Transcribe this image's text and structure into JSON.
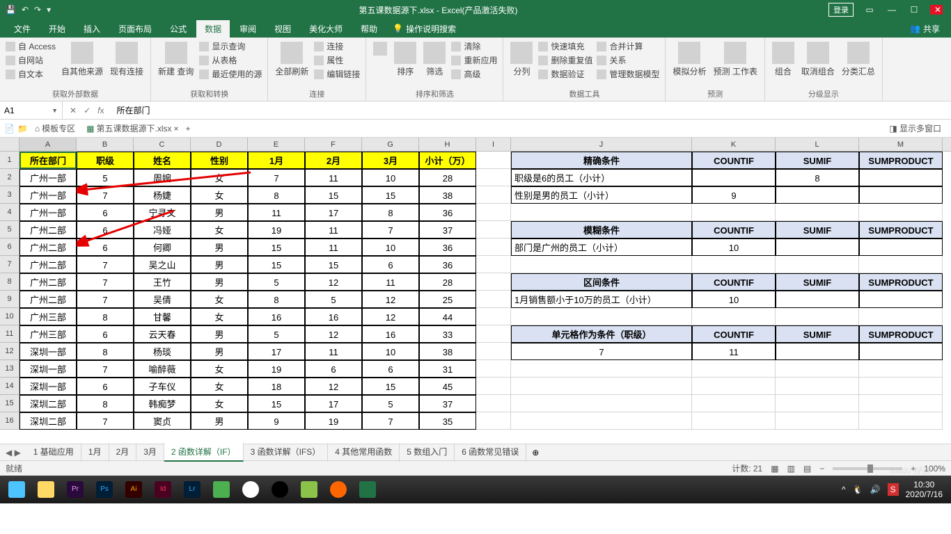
{
  "titlebar": {
    "title": "第五课数据源下.xlsx - Excel(产品激活失败)",
    "login": "登录"
  },
  "tabs": {
    "file": "文件",
    "home": "开始",
    "insert": "插入",
    "layout": "页面布局",
    "formula": "公式",
    "data": "数据",
    "review": "审阅",
    "view": "视图",
    "beautify": "美化大师",
    "help": "帮助",
    "tell": "操作说明搜索",
    "share": "共享"
  },
  "ribbon": {
    "g1": {
      "items": [
        "自 Access",
        "自网站",
        "自文本"
      ],
      "big1": "自其他来源",
      "big2": "现有连接",
      "label": "获取外部数据"
    },
    "g2": {
      "big": "新建\n查询",
      "items": [
        "显示查询",
        "从表格",
        "最近使用的源"
      ],
      "label": "获取和转换"
    },
    "g3": {
      "big": "全部刷新",
      "items": [
        "连接",
        "属性",
        "编辑链接"
      ],
      "label": "连接"
    },
    "g4": {
      "sort": "排序",
      "filter": "筛选",
      "items": [
        "清除",
        "重新应用",
        "高级"
      ],
      "label": "排序和筛选"
    },
    "g5": {
      "big": "分列",
      "items": [
        "快速填充",
        "删除重复值",
        "数据验证"
      ],
      "items2": [
        "合并计算",
        "关系",
        "管理数据模型"
      ],
      "label": "数据工具"
    },
    "g6": {
      "b1": "模拟分析",
      "b2": "预测\n工作表",
      "label": "预测"
    },
    "g7": {
      "b1": "组合",
      "b2": "取消组合",
      "b3": "分类汇总",
      "label": "分级显示"
    }
  },
  "namebox": "A1",
  "fx": "所在部门",
  "filetabs": {
    "tpl": "模板专区",
    "file": "第五课数据源下.xlsx",
    "multi": "显示多窗口"
  },
  "cols": [
    "A",
    "B",
    "C",
    "D",
    "E",
    "F",
    "G",
    "H",
    "I",
    "J",
    "K",
    "L",
    "M"
  ],
  "headers": {
    "A": "所在部门",
    "B": "职级",
    "C": "姓名",
    "D": "性别",
    "E": "1月",
    "F": "2月",
    "G": "3月",
    "H": "小计（万）"
  },
  "data": [
    [
      "广州一部",
      "5",
      "周婉",
      "女",
      "7",
      "11",
      "10",
      "28"
    ],
    [
      "广州一部",
      "7",
      "杨婕",
      "女",
      "8",
      "15",
      "15",
      "38"
    ],
    [
      "广州一部",
      "6",
      "宁寻文",
      "男",
      "11",
      "17",
      "8",
      "36"
    ],
    [
      "广州二部",
      "6",
      "冯娅",
      "女",
      "19",
      "11",
      "7",
      "37"
    ],
    [
      "广州二部",
      "6",
      "何卿",
      "男",
      "15",
      "11",
      "10",
      "36"
    ],
    [
      "广州二部",
      "7",
      "吴之山",
      "男",
      "15",
      "15",
      "6",
      "36"
    ],
    [
      "广州二部",
      "7",
      "王竹",
      "男",
      "5",
      "12",
      "11",
      "28"
    ],
    [
      "广州二部",
      "7",
      "吴倩",
      "女",
      "8",
      "5",
      "12",
      "25"
    ],
    [
      "广州三部",
      "8",
      "甘馨",
      "女",
      "16",
      "16",
      "12",
      "44"
    ],
    [
      "广州三部",
      "6",
      "云天春",
      "男",
      "5",
      "12",
      "16",
      "33"
    ],
    [
      "深圳一部",
      "8",
      "杨琰",
      "男",
      "17",
      "11",
      "10",
      "38"
    ],
    [
      "深圳一部",
      "7",
      "喻醉薇",
      "女",
      "19",
      "6",
      "6",
      "31"
    ],
    [
      "深圳一部",
      "6",
      "子车仪",
      "女",
      "18",
      "12",
      "15",
      "45"
    ],
    [
      "深圳二部",
      "8",
      "韩痴梦",
      "女",
      "15",
      "17",
      "5",
      "37"
    ],
    [
      "深圳二部",
      "7",
      "窦贞",
      "男",
      "9",
      "19",
      "7",
      "35"
    ]
  ],
  "right": {
    "h1": {
      "J": "精确条件",
      "K": "COUNTIF",
      "L": "SUMIF",
      "M": "SUMPRODUCT"
    },
    "r1": {
      "J": "职级是6的员工（小计）",
      "K": "",
      "L": "8",
      "M": ""
    },
    "r2": {
      "J": "性别是男的员工（小计）",
      "K": "9",
      "L": "",
      "M": ""
    },
    "h2": {
      "J": "模糊条件",
      "K": "COUNTIF",
      "L": "SUMIF",
      "M": "SUMPRODUCT"
    },
    "r3": {
      "J": "部门是广州的员工（小计）",
      "K": "10",
      "L": "",
      "M": ""
    },
    "h3": {
      "J": "区间条件",
      "K": "COUNTIF",
      "L": "SUMIF",
      "M": "SUMPRODUCT"
    },
    "r4": {
      "J": "1月销售额小于10万的员工（小计）",
      "K": "10",
      "L": "",
      "M": ""
    },
    "h4": {
      "J": "单元格作为条件（职级）",
      "K": "COUNTIF",
      "L": "SUMIF",
      "M": "SUMPRODUCT"
    },
    "r5": {
      "J": "7",
      "K": "11",
      "L": "",
      "M": ""
    }
  },
  "sheets": [
    "1 基础应用",
    "1月",
    "2月",
    "3月",
    "2 函数详解（IF）",
    "3 函数详解（IFS）",
    "4 其他常用函数",
    "5 数组入门",
    "6 函数常见错误"
  ],
  "activeSheet": 4,
  "status": {
    "ready": "就绪",
    "count": "计数: 21",
    "zoom": "100%"
  },
  "clock": {
    "time": "10:30",
    "date": "2020/7/16"
  },
  "watermark": "Baidu 经验",
  "activate": "激活"
}
